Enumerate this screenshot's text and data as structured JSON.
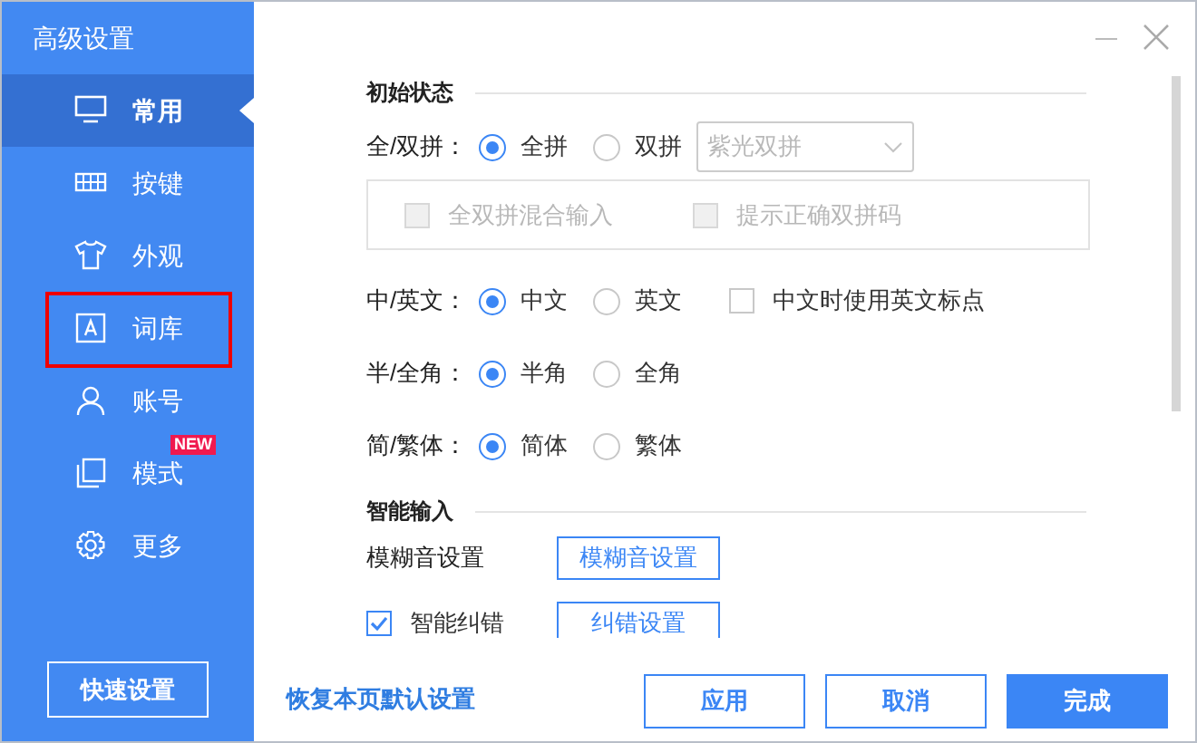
{
  "window": {
    "title": "高级设置"
  },
  "sidebar": {
    "items": [
      {
        "label": "常用",
        "selected": true,
        "highlighted": false
      },
      {
        "label": "按键",
        "selected": false,
        "highlighted": false
      },
      {
        "label": "外观",
        "selected": false,
        "highlighted": false
      },
      {
        "label": "词库",
        "selected": false,
        "highlighted": true
      },
      {
        "label": "账号",
        "selected": false,
        "highlighted": false
      },
      {
        "label": "模式",
        "selected": false,
        "highlighted": false,
        "badge": "NEW"
      },
      {
        "label": "更多",
        "selected": false,
        "highlighted": false
      }
    ],
    "quick_button": "快速设置"
  },
  "sections": [
    {
      "title": "初始状态",
      "rows": [
        {
          "kind": "radio",
          "label": "全/双拼：",
          "options": [
            {
              "label": "全拼",
              "selected": true
            },
            {
              "label": "双拼",
              "selected": false
            }
          ],
          "dropdown": {
            "value": "紫光双拼",
            "disabled": true
          },
          "sub_options": [
            {
              "label": "全双拼混合输入",
              "checked": false,
              "disabled": true
            },
            {
              "label": "提示正确双拼码",
              "checked": false,
              "disabled": true
            }
          ]
        },
        {
          "kind": "radio",
          "label": "中/英文：",
          "options": [
            {
              "label": "中文",
              "selected": true
            },
            {
              "label": "英文",
              "selected": false
            }
          ],
          "checkbox": {
            "label": "中文时使用英文标点",
            "checked": false
          }
        },
        {
          "kind": "radio",
          "label": "半/全角：",
          "options": [
            {
              "label": "半角",
              "selected": true
            },
            {
              "label": "全角",
              "selected": false
            }
          ]
        },
        {
          "kind": "radio",
          "label": "简/繁体：",
          "options": [
            {
              "label": "简体",
              "selected": true
            },
            {
              "label": "繁体",
              "selected": false
            }
          ]
        }
      ]
    },
    {
      "title": "智能输入",
      "rows": [
        {
          "kind": "button",
          "label": "模糊音设置",
          "button": "模糊音设置"
        },
        {
          "kind": "check_button",
          "label": "智能纠错",
          "checked": true,
          "button": "纠错设置"
        }
      ]
    }
  ],
  "footer": {
    "link": "恢复本页默认设置",
    "buttons": [
      {
        "label": "应用",
        "primary": false
      },
      {
        "label": "取消",
        "primary": false
      },
      {
        "label": "完成",
        "primary": true
      }
    ]
  }
}
